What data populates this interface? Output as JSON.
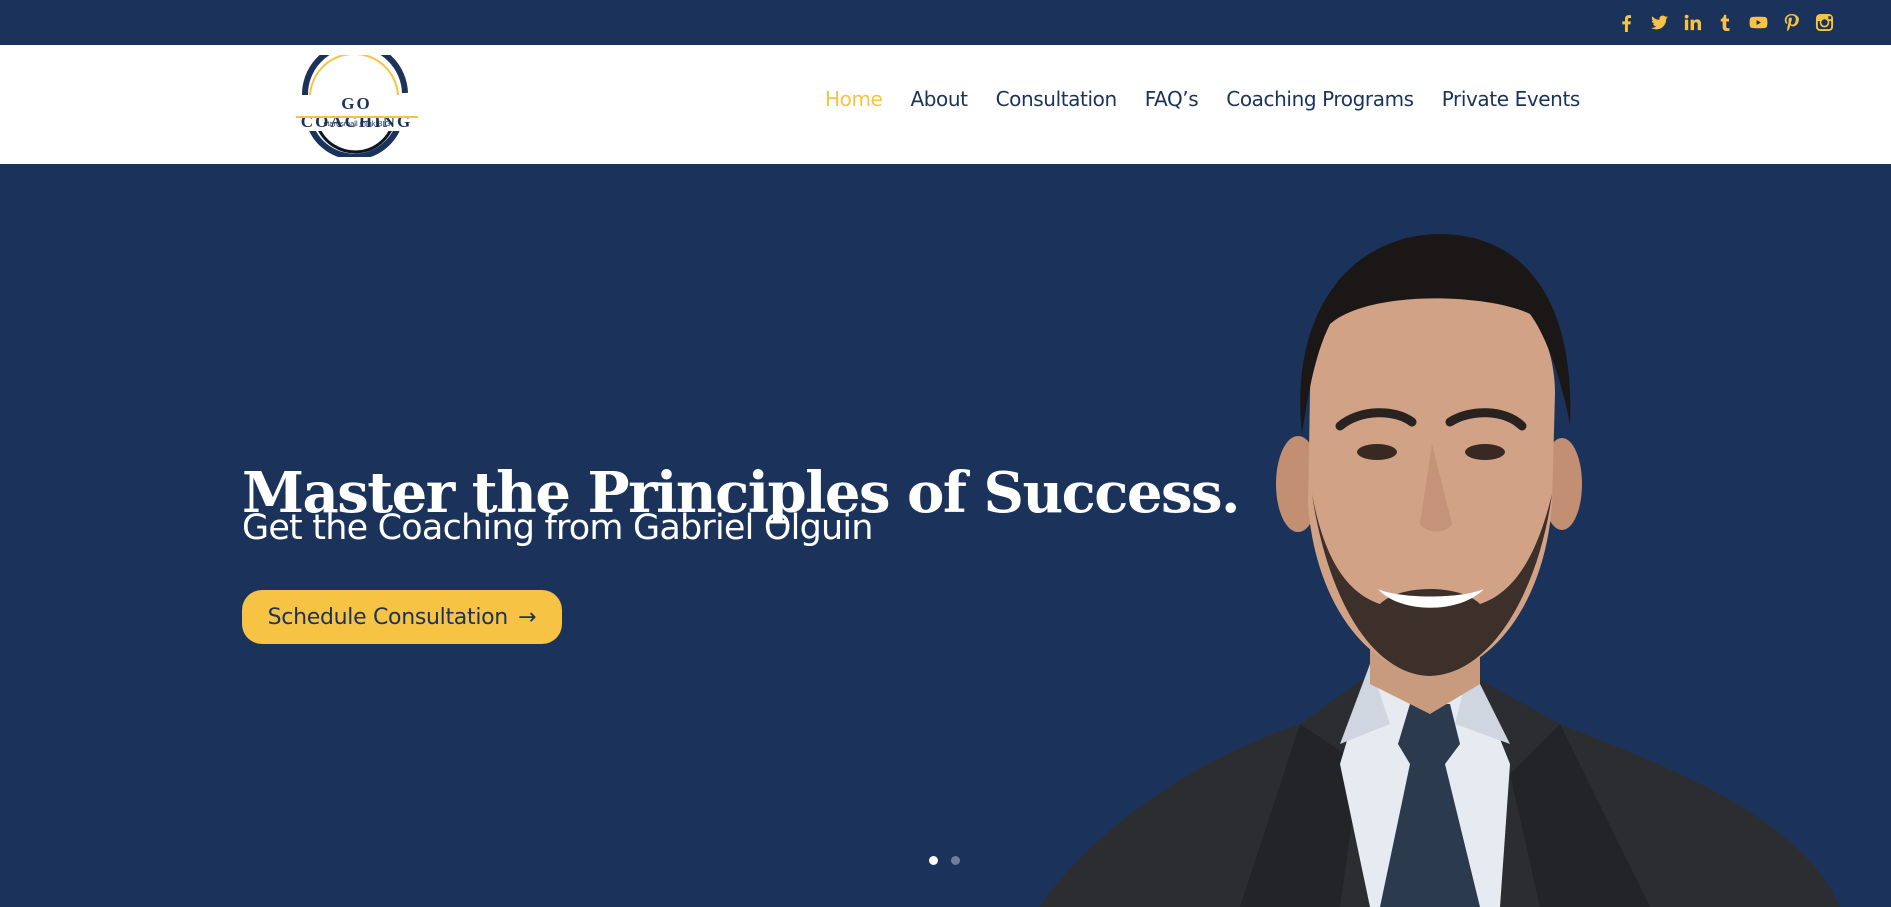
{
  "topbar": {
    "social": [
      {
        "icon": "facebook-icon"
      },
      {
        "icon": "twitter-icon"
      },
      {
        "icon": "linkedin-icon"
      },
      {
        "icon": "tumblr-icon"
      },
      {
        "icon": "youtube-icon"
      },
      {
        "icon": "pinterest-icon"
      },
      {
        "icon": "instagram-icon"
      }
    ]
  },
  "header": {
    "logo": {
      "title": "GO COACHING",
      "tagline": "start small think BIG"
    },
    "nav": [
      {
        "label": "Home",
        "active": true
      },
      {
        "label": "About"
      },
      {
        "label": "Consultation"
      },
      {
        "label": "FAQ’s"
      },
      {
        "label": "Coaching Programs"
      },
      {
        "label": "Private Events"
      }
    ]
  },
  "hero": {
    "title": "Master the Principles of Success.",
    "subtitle": "Get the Coaching from Gabriel Olguin",
    "cta_label": "Schedule Consultation",
    "cta_arrow": "→",
    "slides": {
      "count": 2,
      "active": 1
    }
  },
  "colors": {
    "navy": "#1b335a",
    "accent": "#f6c344",
    "white": "#ffffff"
  }
}
